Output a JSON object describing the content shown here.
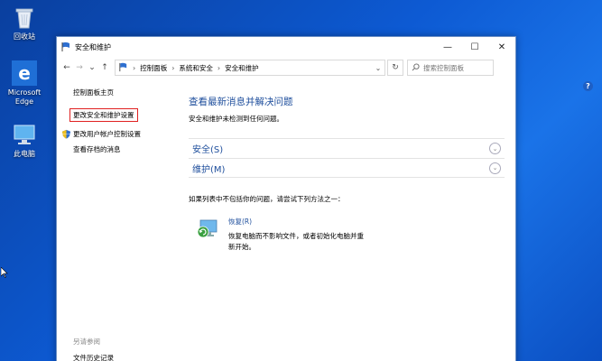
{
  "desktop": {
    "icons": [
      {
        "label": "回收站",
        "icon": "recycle-bin-icon"
      },
      {
        "label": "Microsoft Edge",
        "icon": "edge-icon"
      },
      {
        "label": "此电脑",
        "icon": "this-pc-icon"
      }
    ]
  },
  "window": {
    "title": "安全和维护",
    "controls": {
      "minimize": "—",
      "maximize": "☐",
      "close": "✕"
    },
    "nav": {
      "back": "←",
      "forward": "→",
      "recent": "⌄",
      "up": "↑"
    },
    "breadcrumbs": [
      "控制面板",
      "系统和安全",
      "安全和维护"
    ],
    "refresh": "↻",
    "search_placeholder": "搜索控制面板"
  },
  "leftpane": {
    "home": "控制面板主页",
    "links": [
      "更改安全和维护设置",
      "更改用户帐户控制设置",
      "查看存档的消息"
    ],
    "see_also_heading": "另请参阅",
    "see_also_links": [
      "文件历史记录"
    ]
  },
  "main": {
    "title": "查看最新消息并解决问题",
    "subtitle": "安全和维护未检测到任何问题。",
    "sections": [
      "安全(S)",
      "维护(M)"
    ],
    "hint": "如果列表中不包括你的问题，请尝试下列方法之一：",
    "recovery": {
      "link": "恢复(R)",
      "desc": "恢复电脑而不影响文件，或者初始化电脑并重新开始。"
    }
  },
  "colors": {
    "accent": "#1e4e9c",
    "desktop": "#0d5ad3",
    "highlight_border": "#e02020"
  }
}
